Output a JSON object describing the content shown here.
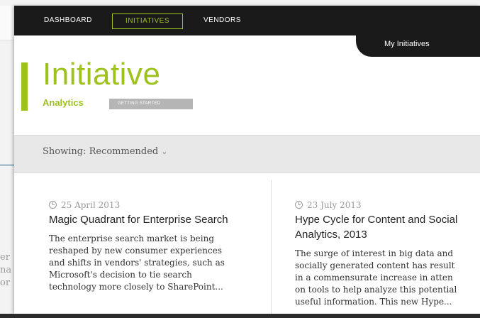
{
  "nav": {
    "items": [
      "DASHBOARD",
      "INITIATIVES",
      "VENDORS"
    ],
    "my_initiatives": "My Initiatives"
  },
  "header": {
    "title": "Initiative",
    "subtitle": "Analytics",
    "badge": "GETTING STARTED"
  },
  "filter": {
    "label": "Showing: Recommended"
  },
  "background": {
    "side_text": [
      "er",
      "na",
      "or"
    ]
  },
  "cards": [
    {
      "date": "25 April 2013",
      "title": [
        "Magic Quadrant for Enterprise Search"
      ],
      "description": [
        "The enterprise search market is being",
        "reshaped by new consumer experiences",
        "and shifts in vendors' strategies, such as",
        "Microsoft's decision to tie search",
        "technology more closely to SharePoint..."
      ]
    },
    {
      "date": "23 July 2013",
      "title": [
        "Hype Cycle for Content and Social",
        "Analytics, 2013"
      ],
      "description": [
        "The surge of interest in big data and",
        "socially generated content has result",
        "in a commensurate increase in atten",
        "on tools to help analyze this potential",
        "useful information. This new Hype..."
      ]
    }
  ],
  "colors": {
    "accent": "#9dc21d",
    "nav_bg": "#1a1a1a",
    "filter_bg": "#e8e8e8"
  }
}
